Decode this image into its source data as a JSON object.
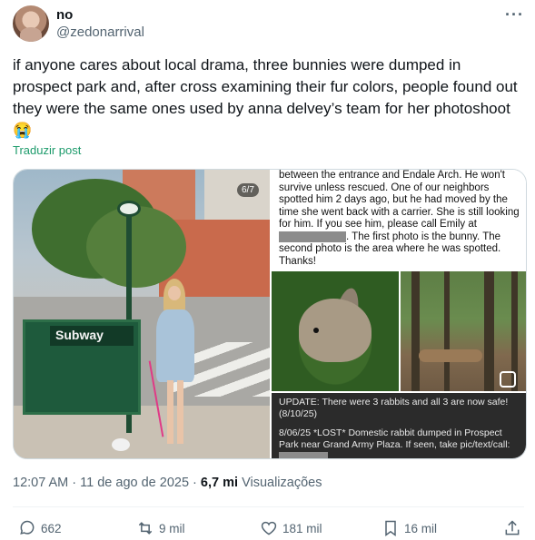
{
  "author": {
    "name": "no",
    "handle": "@zedonarrival"
  },
  "post": {
    "text": "if anyone cares about local drama, three bunnies were dumped in prospect park and, after cross examining their fur colors, people found out they were the same ones used by anna delvey’s team for her photoshoot 😭",
    "translate_label": "Traduzir post",
    "media_counter": "6/7",
    "subway_sign": "Subway",
    "flyer": {
      "line_a": "between the entrance and Endale Arch. He won't survive unless rescued. One of our neighbors spotted him 2 days ago, but he had moved by the time she went back with a carrier. She is still looking for him. If you see him, please call Emily at",
      "line_b": ". The first photo is the bunny. The second photo is the area where he was spotted. Thanks!",
      "update": "UPDATE:  There were 3 rabbits and all 3 are now safe! (8/10/25)",
      "lost": "8/06/25 *LOST* Domestic rabbit dumped in Prospect Park near Grand Army Plaza. If seen, take pic/text/call:"
    },
    "time": "12:07 AM",
    "date": "11 de ago de 2025",
    "views_count": "6,7 mi",
    "views_label": "Visualizações"
  },
  "actions": {
    "replies": "662",
    "reposts": "9 mil",
    "likes": "181 mil",
    "bookmarks": "16 mil"
  },
  "colors": {
    "translate_link": "#1d9b6b",
    "secondary_text": "#536471"
  }
}
